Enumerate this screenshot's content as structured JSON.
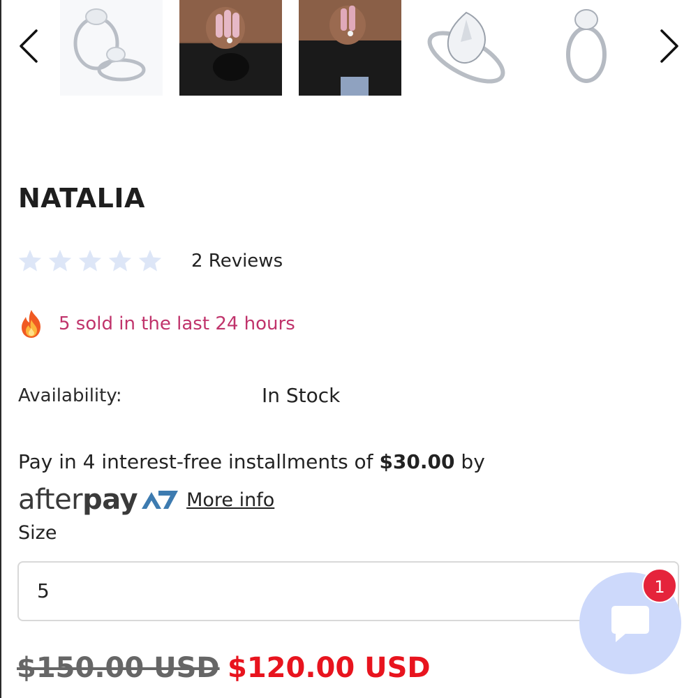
{
  "colors": {
    "sold_text": "#c0336b",
    "sale_price": "#e8141e",
    "star_empty": "#dde6f7",
    "chat_button": "#cdd9fb",
    "chat_badge": "#e5243b",
    "afterpay_mark": "#3d7bb0"
  },
  "carousel": {
    "prev_icon": "chevron-left-icon",
    "next_icon": "chevron-right-icon",
    "thumbnails": [
      {
        "name": "ring-oval-solitaire-pair"
      },
      {
        "name": "model-hand-ring-black-top"
      },
      {
        "name": "model-hand-ring-black-top-alt"
      },
      {
        "name": "ring-pear-cut-halo"
      },
      {
        "name": "ring-oval-side-view"
      }
    ]
  },
  "product": {
    "title": "NATALIA",
    "rating_stars": 5,
    "rating_filled": 0,
    "reviews_text": "2 Reviews",
    "sold_icon": "fire-icon",
    "sold_text": "5 sold in the last 24 hours",
    "availability_label": "Availability:",
    "availability_value": "In Stock"
  },
  "payment": {
    "installments_prefix": "Pay in 4 interest-free installments of ",
    "installment_amount": "$30.00",
    "installments_suffix": " by",
    "provider_after": "after",
    "provider_pay": "pay",
    "more_info": "More info"
  },
  "size": {
    "label": "Size",
    "selected": "5"
  },
  "price": {
    "original": "$150.00 USD",
    "sale": "$120.00 USD"
  },
  "chat": {
    "icon": "chat-bubble-icon",
    "badge_count": "1"
  }
}
